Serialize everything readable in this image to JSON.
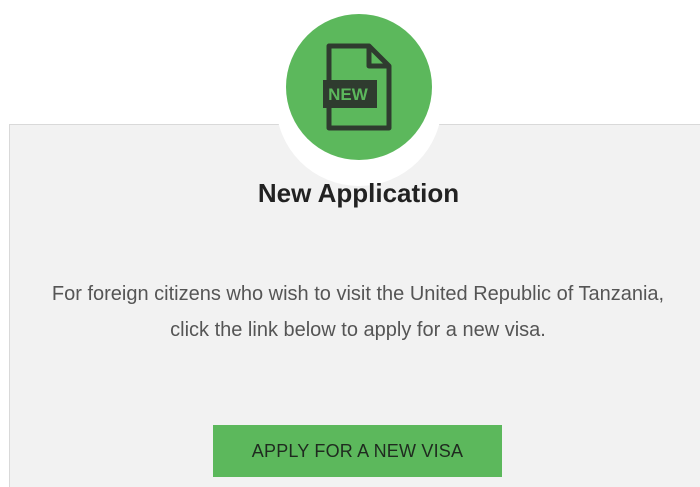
{
  "card": {
    "icon": "new-document-icon",
    "icon_badge_text": "NEW",
    "title": "New Application",
    "description": "For foreign citizens who wish to visit the United Republic of Tanzania, click the link below to apply for a new visa.",
    "button_label": "APPLY FOR A NEW VISA"
  },
  "colors": {
    "accent_green": "#5cb85c",
    "card_background": "#f2f2f2",
    "icon_dark": "#2f3b2f",
    "text_dark": "#222222",
    "text_muted": "#555555"
  }
}
